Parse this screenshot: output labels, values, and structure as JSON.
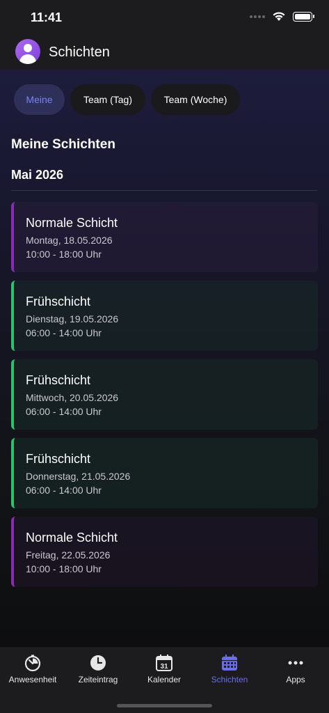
{
  "status_bar": {
    "time": "11:41"
  },
  "header": {
    "title": "Schichten"
  },
  "segments": [
    {
      "label": "Meine",
      "active": true
    },
    {
      "label": "Team (Tag)",
      "active": false
    },
    {
      "label": "Team (Woche)",
      "active": false
    }
  ],
  "section": {
    "title": "Meine Schichten",
    "month": "Mai 2026"
  },
  "shifts": [
    {
      "name": "Normale Schicht",
      "date": "Montag, 18.05.2026",
      "time": "10:00 - 18:00 Uhr",
      "color": "#8a2bb5"
    },
    {
      "name": "Frühschicht",
      "date": "Dienstag, 19.05.2026",
      "time": "06:00 - 14:00 Uhr",
      "color": "#2bc46a"
    },
    {
      "name": "Frühschicht",
      "date": "Mittwoch, 20.05.2026",
      "time": "06:00 - 14:00 Uhr",
      "color": "#2bc46a"
    },
    {
      "name": "Frühschicht",
      "date": "Donnerstag, 21.05.2026",
      "time": "06:00 - 14:00 Uhr",
      "color": "#2bc46a"
    },
    {
      "name": "Normale Schicht",
      "date": "Freitag, 22.05.2026",
      "time": "10:00 - 18:00 Uhr",
      "color": "#8a2bb5"
    }
  ],
  "tab_bar": [
    {
      "label": "Anwesenheit",
      "icon": "stopwatch-icon",
      "active": false
    },
    {
      "label": "Zeiteintrag",
      "icon": "clock-icon",
      "active": false
    },
    {
      "label": "Kalender",
      "icon": "calendar-icon",
      "icon_text": "31",
      "active": false
    },
    {
      "label": "Schichten",
      "icon": "shift-calendar-icon",
      "active": true
    },
    {
      "label": "Apps",
      "icon": "more-dots-icon",
      "active": false
    }
  ],
  "colors": {
    "accent": "#6a6fe8",
    "normal_shift": "#8a2bb5",
    "early_shift": "#2bc46a"
  }
}
